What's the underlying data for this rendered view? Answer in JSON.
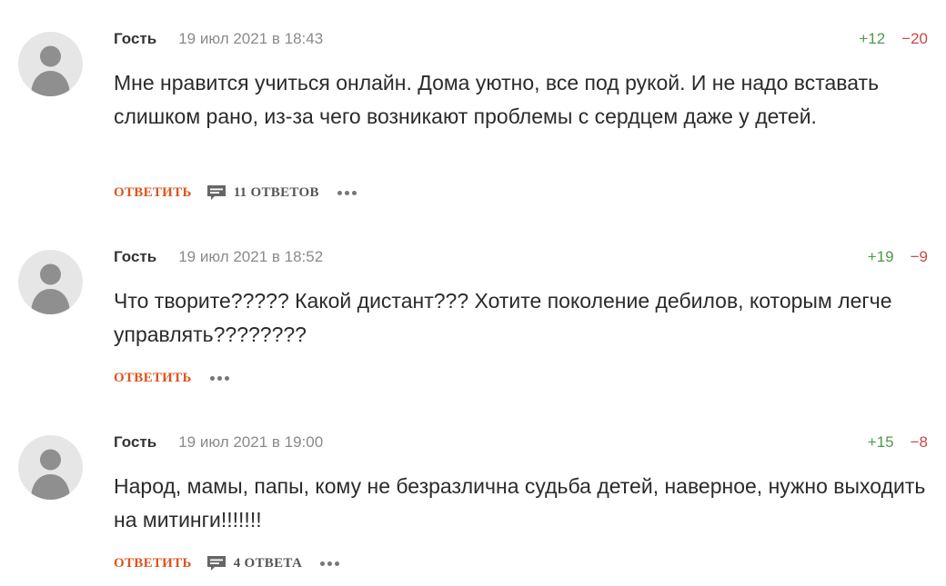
{
  "colors": {
    "reply": "#e0531c",
    "vote_up": "#4f9a4a",
    "vote_down": "#c94848",
    "meta": "#8a8a8a",
    "avatar_bg": "#e6e6e6",
    "avatar_fg": "#8f8f8f"
  },
  "icons": {
    "avatar": "user-silhouette-icon",
    "replies": "speech-bubble-icon",
    "more": "ellipsis-icon"
  },
  "comments": [
    {
      "author": "Гость",
      "date": "19 июл 2021 в 18:43",
      "votes_up": "+12",
      "votes_down": "−20",
      "text": "Мне нравится учиться онлайн. Дома уютно, все под рукой. И не надо вставать слишком рано, из-за чего возникают проблемы с сердцем даже у детей.",
      "reply_label": "ОТВЕТИТЬ",
      "replies_label": "11 ОТВЕТОВ"
    },
    {
      "author": "Гость",
      "date": "19 июл 2021 в 18:52",
      "votes_up": "+19",
      "votes_down": "−9",
      "text": "Что творите????? Какой дистант??? Хотите поколение дебилов, которым легче управлять????????",
      "reply_label": "ОТВЕТИТЬ"
    },
    {
      "author": "Гость",
      "date": "19 июл 2021 в 19:00",
      "votes_up": "+15",
      "votes_down": "−8",
      "text": "Народ, мамы, папы, кому не безразлична судьба детей, наверное, нужно выходить на митинги!!!!!!!",
      "reply_label": "ОТВЕТИТЬ",
      "replies_label": "4 ОТВЕТА"
    }
  ]
}
